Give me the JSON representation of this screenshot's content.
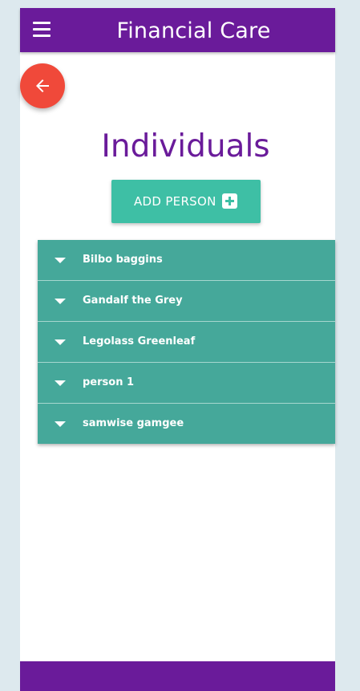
{
  "header": {
    "title": "Financial Care",
    "menu_icon": "hamburger-menu-icon"
  },
  "back_button": {
    "icon": "arrow-left-icon"
  },
  "main": {
    "title": "Individuals",
    "add_button_label": "ADD PERSON",
    "add_button_icon": "plus-square-icon"
  },
  "people": [
    {
      "name": "Bilbo baggins"
    },
    {
      "name": "Gandalf the Grey"
    },
    {
      "name": "Legolass Greenleaf"
    },
    {
      "name": "person 1"
    },
    {
      "name": "samwise gamgee"
    }
  ],
  "colors": {
    "primary": "#6a1b9a",
    "accent": "#3ebfa5",
    "list_background": "#45a89a",
    "back_button": "#f0493a",
    "page_background": "#dde9ee"
  }
}
